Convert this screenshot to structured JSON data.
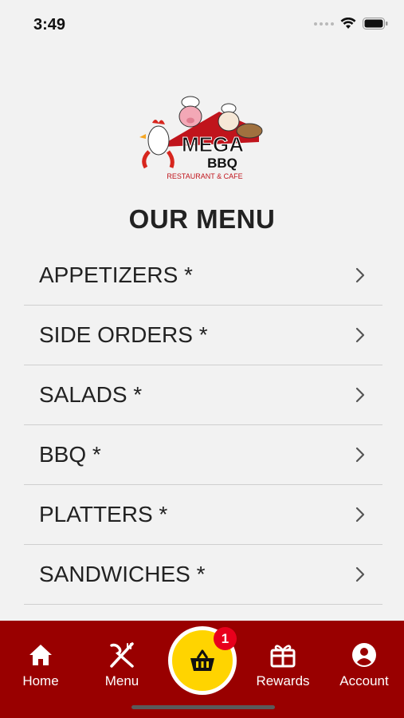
{
  "status_bar": {
    "time": "3:49"
  },
  "menu": {
    "title": "OUR MENU",
    "categories": [
      {
        "label": "APPETIZERS *"
      },
      {
        "label": "SIDE ORDERS *"
      },
      {
        "label": "SALADS *"
      },
      {
        "label": "BBQ *"
      },
      {
        "label": "PLATTERS *"
      },
      {
        "label": "SANDWICHES *"
      }
    ]
  },
  "logo": {
    "brand": "MEGA",
    "sub": "BBQ",
    "tagline": "RESTAURANT & CAFE"
  },
  "tabs": {
    "home": {
      "label": "Home",
      "icon": "home-icon"
    },
    "menu": {
      "label": "Menu",
      "icon": "utensils-icon"
    },
    "cart": {
      "icon": "basket-icon",
      "badge": "1"
    },
    "rewards": {
      "label": "Rewards",
      "icon": "gift-icon"
    },
    "account": {
      "label": "Account",
      "icon": "user-circle-icon"
    }
  },
  "colors": {
    "tab_bar": "#990000",
    "cart_button": "#ffd400",
    "badge": "#e8001c",
    "background": "#f2f2f2"
  }
}
